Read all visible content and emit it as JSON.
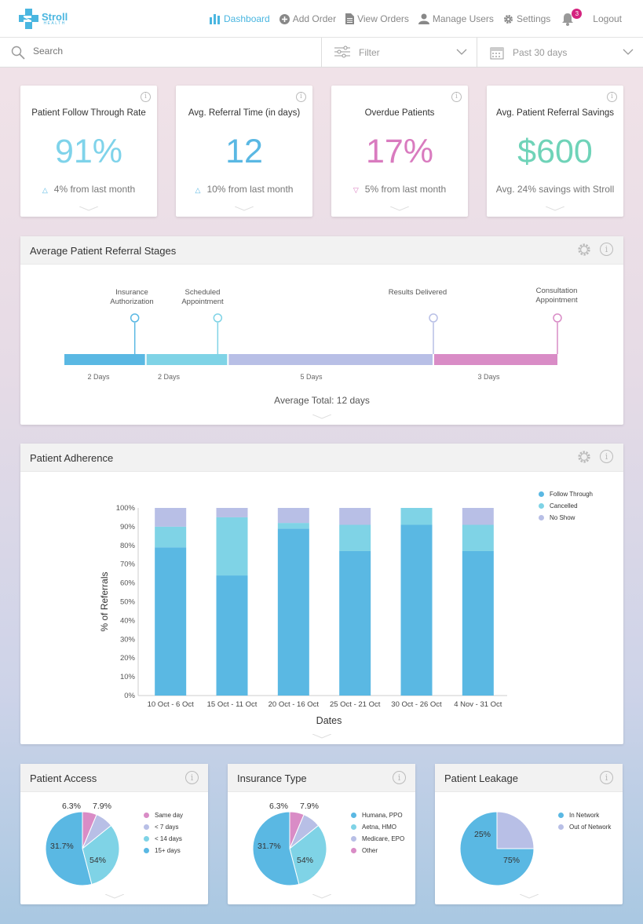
{
  "brand": {
    "name": "Stroll",
    "sub": "HEALTH",
    "color": "#4ab6e0"
  },
  "nav": {
    "items": [
      {
        "label": "Dashboard",
        "icon": "bar-chart-icon",
        "active": true
      },
      {
        "label": "Add Order",
        "icon": "plus-circle-icon"
      },
      {
        "label": "View Orders",
        "icon": "document-icon"
      },
      {
        "label": "Manage Users",
        "icon": "user-icon"
      },
      {
        "label": "Settings",
        "icon": "gear-icon"
      }
    ],
    "notification_count": "3",
    "logout": "Logout"
  },
  "toolbar": {
    "search_placeholder": "Search",
    "filter_label": "Filter",
    "date_label": "Past 30 days"
  },
  "stats": [
    {
      "title": "Patient Follow Through Rate",
      "value": "91%",
      "color": "#7fd3ea",
      "trend": "up",
      "foot": "4% from last month"
    },
    {
      "title": "Avg. Referral Time (in days)",
      "value": "12",
      "color": "#5ab8e3",
      "trend": "up",
      "foot": "10% from last month"
    },
    {
      "title": "Overdue Patients",
      "value": "17%",
      "color": "#d97bbf",
      "trend": "down",
      "foot": "5% from last month"
    },
    {
      "title": "Avg. Patient Referral Savings",
      "value": "$600",
      "color": "#6fd3b8",
      "trend": "none",
      "foot": "Avg. 24% savings with Stroll"
    }
  ],
  "stages_panel": {
    "title": "Average Patient Referral Stages",
    "milestones": [
      "Insurance Authorization",
      "Scheduled Appointment",
      "Results Delivered",
      "Consultation Appointment"
    ],
    "segments": [
      {
        "label": "2 Days",
        "days": 2,
        "color": "#5ab8e3"
      },
      {
        "label": "2 Days",
        "days": 2,
        "color": "#7fd3e6"
      },
      {
        "label": "5 Days",
        "days": 5,
        "color": "#b8bfe6"
      },
      {
        "label": "3 Days",
        "days": 3,
        "color": "#d98cc6"
      }
    ],
    "total": "Average Total: 12 days"
  },
  "adherence_panel": {
    "title": "Patient Adherence"
  },
  "chart_data": [
    {
      "type": "bar",
      "stacked": true,
      "categories": [
        "10 Oct - 6 Oct",
        "15 Oct - 11 Oct",
        "20 Oct - 16 Oct",
        "25 Oct - 21 Oct",
        "30 Oct - 26 Oct",
        "4 Nov - 31 Oct"
      ],
      "series": [
        {
          "name": "Follow Through",
          "color": "#5ab8e3",
          "values": [
            79,
            64,
            89,
            77,
            91,
            77
          ]
        },
        {
          "name": "Cancelled",
          "color": "#7fd3e6",
          "values": [
            11,
            31,
            3,
            14,
            9,
            14
          ]
        },
        {
          "name": "No Show",
          "color": "#b8bfe6",
          "values": [
            10,
            5,
            8,
            9,
            0,
            9
          ]
        }
      ],
      "xlabel": "Dates",
      "ylabel": "% of Referrals",
      "yticks": [
        "0%",
        "10%",
        "20%",
        "30%",
        "40%",
        "50%",
        "60%",
        "70%",
        "80%",
        "90%",
        "100%"
      ],
      "ylim": [
        0,
        100
      ],
      "legend": "top-right"
    },
    {
      "type": "pie",
      "title": "Patient Access",
      "slices": [
        {
          "label": "Same day",
          "value": 6.3,
          "text": "6.3%",
          "color": "#d98cc6"
        },
        {
          "label": "< 7 days",
          "value": 7.9,
          "text": "7.9%",
          "color": "#b8bfe6"
        },
        {
          "label": "< 14 days",
          "value": 31.7,
          "text": "31.7%",
          "color": "#7fd3e6"
        },
        {
          "label": "15+ days",
          "value": 54,
          "text": "54%",
          "color": "#5ab8e3"
        }
      ]
    },
    {
      "type": "pie",
      "title": "Insurance Type",
      "slices": [
        {
          "label": "Other",
          "value": 6.3,
          "text": "6.3%",
          "color": "#d98cc6"
        },
        {
          "label": "Medicare, EPO",
          "value": 7.9,
          "text": "7.9%",
          "color": "#b8bfe6"
        },
        {
          "label": "Aetna, HMO",
          "value": 31.7,
          "text": "31.7%",
          "color": "#7fd3e6"
        },
        {
          "label": "Humana, PPO",
          "value": 54,
          "text": "54%",
          "color": "#5ab8e3"
        }
      ],
      "legend_order": [
        "Humana, PPO",
        "Aetna, HMO",
        "Medicare, EPO",
        "Other"
      ]
    },
    {
      "type": "pie",
      "title": "Patient Leakage",
      "slices": [
        {
          "label": "Out of Network",
          "value": 25,
          "text": "25%",
          "color": "#b8bfe6"
        },
        {
          "label": "In Network",
          "value": 75,
          "text": "75%",
          "color": "#5ab8e3"
        }
      ],
      "legend_order": [
        "In Network",
        "Out of Network"
      ]
    }
  ]
}
